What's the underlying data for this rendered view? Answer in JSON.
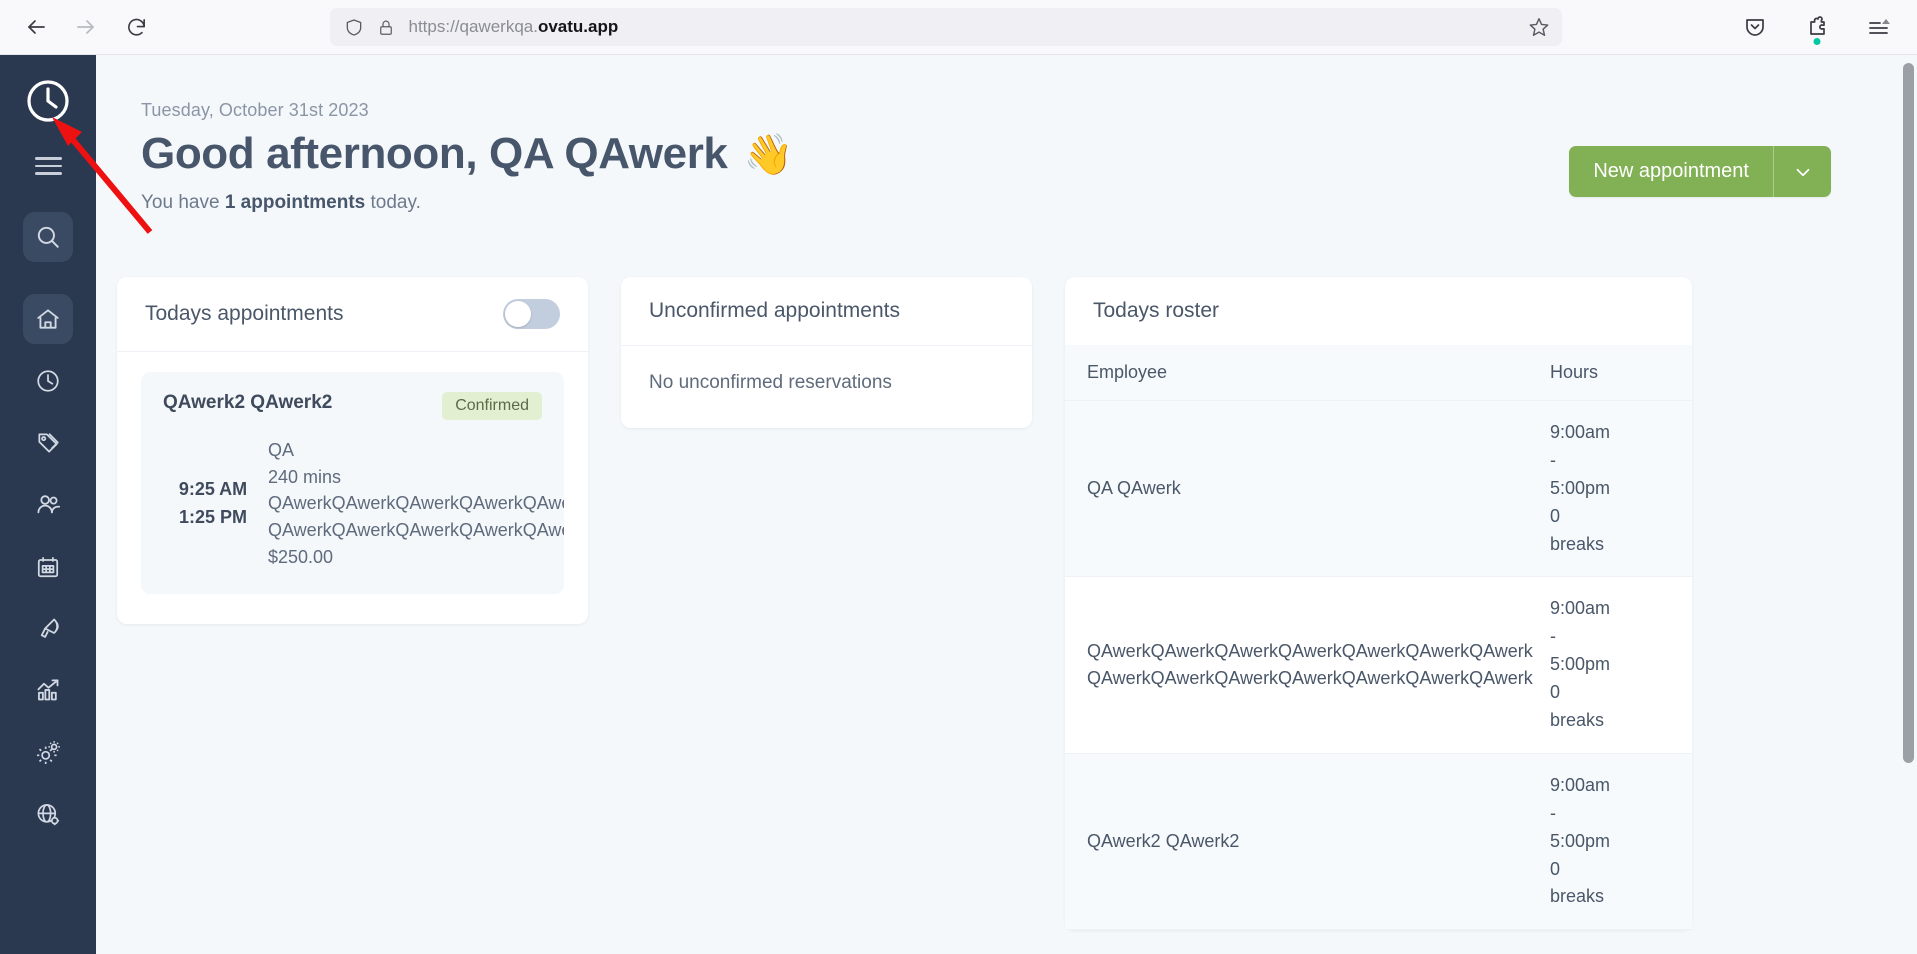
{
  "browser": {
    "url_prefix": "https://qawerkqa.",
    "url_domain": "ovatu.app",
    "icons": {
      "back": "back-arrow-icon",
      "forward": "forward-arrow-icon",
      "reload": "reload-icon",
      "shield": "shield-icon",
      "lock": "padlock-icon",
      "bookmark": "star-icon",
      "pocket": "pocket-save-icon",
      "extensions": "extensions-puzzle-icon",
      "menu": "app-menu-icon"
    }
  },
  "sidebar": {
    "logo": "clock-logo-icon",
    "menu_toggle": "hamburger-menu-icon",
    "items": [
      {
        "name": "search",
        "icon": "search-icon",
        "active": true
      },
      {
        "name": "home",
        "icon": "home-icon",
        "active": true
      },
      {
        "name": "clock",
        "icon": "clock-icon",
        "active": false
      },
      {
        "name": "tag",
        "icon": "tag-icon",
        "active": false
      },
      {
        "name": "clients",
        "icon": "people-icon",
        "active": false
      },
      {
        "name": "calendar",
        "icon": "calendar-icon",
        "active": false
      },
      {
        "name": "marketing",
        "icon": "megaphone-icon",
        "active": false
      },
      {
        "name": "reports",
        "icon": "chart-trend-icon",
        "active": false
      },
      {
        "name": "settings",
        "icon": "gears-icon",
        "active": false
      },
      {
        "name": "site-settings",
        "icon": "globe-gear-icon",
        "active": false
      }
    ]
  },
  "header": {
    "date": "Tuesday, October 31st 2023",
    "greeting": "Good afternoon, QA QAwerk",
    "wave_emoji": "👋",
    "subtitle_pre": "You have ",
    "subtitle_strong": "1 appointments",
    "subtitle_post": " today.",
    "new_appointment_label": "New appointment",
    "new_appointment_caret": "chevron-down-icon",
    "accent_green": "#82b055"
  },
  "todays_appointments": {
    "title": "Todays appointments",
    "toggle_state": "off",
    "appointment": {
      "client": "QAwerk2 QAwerk2",
      "status": "Confirmed",
      "status_color": "#e2efd0",
      "start_time": "9:25 AM",
      "end_time": "1:25 PM",
      "service": "QA",
      "duration": "240 mins",
      "note_line1": "QAwerkQAwerkQAwerkQAwerkQAwerkQAwerkQAwerk",
      "note_line2": "QAwerkQAwerkQAwerkQAwerkQAwerkQAwerkQAwerk",
      "price": "$250.00"
    }
  },
  "unconfirmed_appointments": {
    "title": "Unconfirmed appointments",
    "empty_message": "No unconfirmed reservations"
  },
  "todays_roster": {
    "title": "Todays roster",
    "columns": [
      "Employee",
      "Hours"
    ],
    "rows": [
      {
        "employee": "QA QAwerk",
        "hours_start": "9:00am",
        "hours_dash": "-",
        "hours_end": "5:00pm",
        "breaks_count": "0",
        "breaks_label": "breaks"
      },
      {
        "employee": "QAwerkQAwerkQAwerkQAwerkQAwerkQAwerkQAwerk QAwerkQAwerkQAwerkQAwerkQAwerkQAwerkQAwerk",
        "hours_start": "9:00am",
        "hours_dash": "-",
        "hours_end": "5:00pm",
        "breaks_count": "0",
        "breaks_label": "breaks"
      },
      {
        "employee": "QAwerk2 QAwerk2",
        "hours_start": "9:00am",
        "hours_dash": "-",
        "hours_end": "5:00pm",
        "breaks_count": "0",
        "breaks_label": "breaks"
      }
    ]
  },
  "annotation": {
    "type": "red-arrow",
    "color": "#ee1111",
    "points_to": "clock-logo-icon"
  }
}
